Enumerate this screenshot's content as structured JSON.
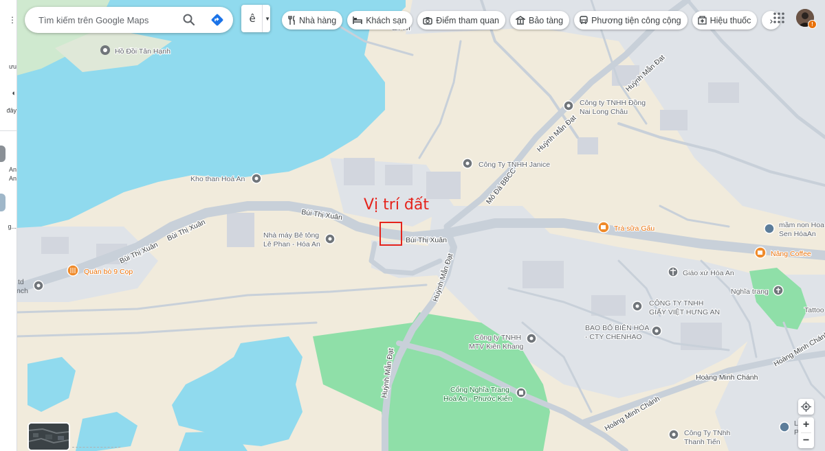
{
  "search": {
    "placeholder": "Tìm kiếm trên Google Maps"
  },
  "language": {
    "label": "ê"
  },
  "chips": [
    {
      "label": "Nhà hàng",
      "icon": "fork-knife-icon"
    },
    {
      "label": "Khách sạn",
      "icon": "bed-icon"
    },
    {
      "label": "Điểm tham quan",
      "icon": "camera-icon"
    },
    {
      "label": "Bảo tàng",
      "icon": "museum-icon"
    },
    {
      "label": "Phương tiện công cộng",
      "icon": "bus-icon"
    },
    {
      "label": "Hiệu thuốc",
      "icon": "pharmacy-icon"
    }
  ],
  "left_rail": {
    "items": [
      "ưu",
      "đây",
      "An",
      "An",
      "g..."
    ]
  },
  "annotation": {
    "label": "Vị trí đất",
    "color": "#e5231b"
  },
  "places": [
    {
      "name": "Hồ Đồi Tân Hạnh",
      "type": "gray"
    },
    {
      "name": "Kho than Hoá An",
      "type": "gray"
    },
    {
      "name": "Nhà máy Bê tông",
      "line2": "Lê Phan - Hóa An",
      "type": "gray"
    },
    {
      "name": "Quán bò 9 Cọp",
      "type": "food"
    },
    {
      "name": "td",
      "line2": "nch",
      "type": "gray"
    },
    {
      "name": "Công ty TNHH Đồng",
      "line2": "Nai Long Châu",
      "type": "gray"
    },
    {
      "name": "Công Ty TNHH Janice",
      "type": "gray"
    },
    {
      "name": "Trà sữa Gấu",
      "type": "food"
    },
    {
      "name": "mầm non Hoa",
      "line2": "Sen HóaAn",
      "type": "school"
    },
    {
      "name": "Nâng Coffee",
      "type": "food"
    },
    {
      "name": "Giáo xứ Hóa An",
      "type": "church"
    },
    {
      "name": "Nghĩa trang",
      "type": "cemetery"
    },
    {
      "name": "CÔNG TY TNHH",
      "line2": "GIẤY VIỆT HƯNG AN",
      "type": "gray"
    },
    {
      "name": "Tattoo",
      "type": "gray"
    },
    {
      "name": "BAO BỐ BIÊN HÒA",
      "line2": "- CTY CHENHAO",
      "type": "gray"
    },
    {
      "name": "Công ty TNHH",
      "line2": "MTV Kiên Khang",
      "type": "gray"
    },
    {
      "name": "Cổng Nghĩa Trang",
      "line2": "Hoá An - Phước Kiển",
      "type": "cemetery"
    },
    {
      "name": "Công Ty TNhh",
      "line2": "Thanh Tiến",
      "type": "gray"
    },
    {
      "name": "Lị",
      "line2": "Phú N",
      "type": "school"
    }
  ],
  "roads": [
    {
      "name": "Bùi Thị Xuân"
    },
    {
      "name": "Bùi Thị Xuân"
    },
    {
      "name": "Bùi Thị Xuân"
    },
    {
      "name": "Bùi Thị Xuân"
    },
    {
      "name": "Huỳnh Mẫn Đạt"
    },
    {
      "name": "Huỳnh Mẫn Đạt"
    },
    {
      "name": "Huỳnh Mẫn Đạt"
    },
    {
      "name": "Huỳnh Mẫn Đạt"
    },
    {
      "name": "Mỏ Đá BBCC"
    },
    {
      "name": "Hoàng Minh Chánh"
    },
    {
      "name": "Hoàng Minh Chánh"
    },
    {
      "name": "Hoàng Minh Chánh"
    },
    {
      "name": "ấn Th"
    }
  ],
  "colors": {
    "land": "#f1ebdc",
    "water": "#90daee",
    "park": "#8fdfa8",
    "urban": "#dfe3e8",
    "road": "#c8d0d9",
    "poi_gray": "#70757a",
    "poi_food": "#ef8a2a",
    "poi_school": "#5c7d9a"
  }
}
